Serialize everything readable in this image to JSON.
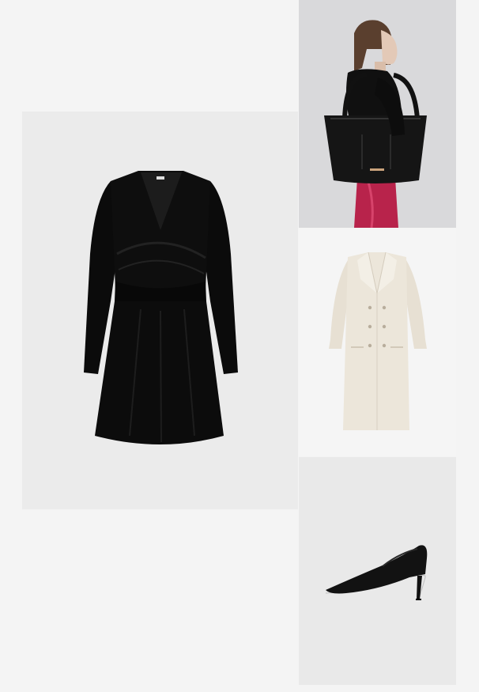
{
  "collage": {
    "items": [
      {
        "id": "dress",
        "product": "wrap-dress",
        "color_hex": "#0b0b0b",
        "background_hex": "#ebebeb"
      },
      {
        "id": "bag",
        "product": "tote-bag-on-model",
        "color_hex": "#111111",
        "background_hex": "#d9d9db"
      },
      {
        "id": "coat",
        "product": "double-breasted-coat",
        "color_hex": "#ece6da",
        "background_hex": "#f5f5f5"
      },
      {
        "id": "pump",
        "product": "pointed-pump",
        "color_hex": "#121212",
        "background_hex": "#e9e9e9"
      }
    ]
  }
}
